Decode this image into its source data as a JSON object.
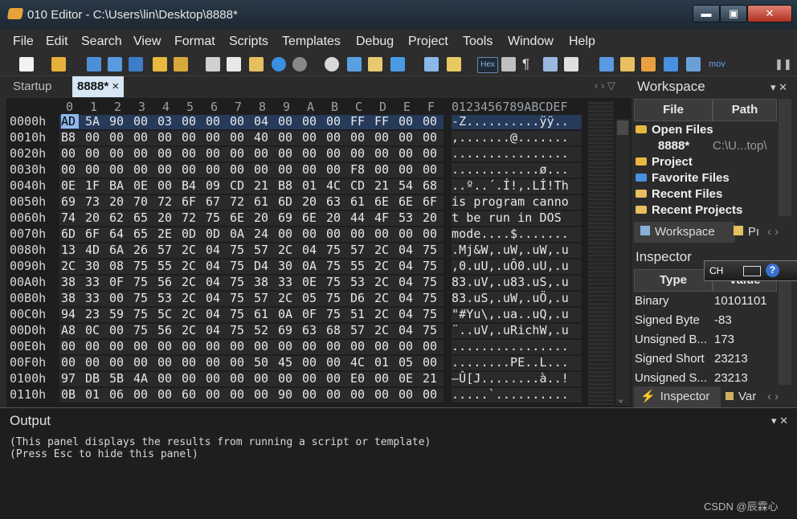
{
  "window": {
    "title": "010 Editor - C:\\Users\\lin\\Desktop\\8888*",
    "min": "▬",
    "max": "▣",
    "close": "✕"
  },
  "menu": [
    "File",
    "Edit",
    "Search",
    "View",
    "Format",
    "Scripts",
    "Templates",
    "Debug",
    "Project",
    "Tools",
    "Window",
    "Help"
  ],
  "toolbar": {
    "hex_label": "Hex",
    "mov_label": "mov",
    "icons": [
      "new-file-icon",
      "open-folder-icon",
      "save-icon",
      "save-all-icon",
      "save-copy-icon",
      "folder-icon",
      "open-multiple-icon",
      "cut-icon",
      "copy-icon",
      "paste-icon",
      "undo-icon",
      "redo-icon",
      "find-icon",
      "replace-icon",
      "find-in-files-icon",
      "goto-icon",
      "run-script-icon",
      "run-template-icon",
      "hex-icon",
      "format-icon",
      "pilcrow-icon",
      "columns-icon",
      "highlight-icon",
      "calculator-icon",
      "import-icon",
      "compare-icon",
      "histogram-icon",
      "checksum-icon",
      "mov-icon",
      "pause-icon"
    ]
  },
  "tabs": {
    "startup": "Startup",
    "file": "8888*",
    "close": "×",
    "nav": "‹ › ▽"
  },
  "hex": {
    "columns": [
      "0",
      "1",
      "2",
      "3",
      "4",
      "5",
      "6",
      "7",
      "8",
      "9",
      "A",
      "B",
      "C",
      "D",
      "E",
      "F"
    ],
    "ascii_header": "0123456789ABCDEF",
    "rows": [
      {
        "addr": "0000h",
        "bytes": [
          "AD",
          "5A",
          "90",
          "00",
          "03",
          "00",
          "00",
          "00",
          "04",
          "00",
          "00",
          "00",
          "FF",
          "FF",
          "00",
          "00"
        ],
        "ascii": "-Z..........ÿÿ.."
      },
      {
        "addr": "0010h",
        "bytes": [
          "B8",
          "00",
          "00",
          "00",
          "00",
          "00",
          "00",
          "00",
          "40",
          "00",
          "00",
          "00",
          "00",
          "00",
          "00",
          "00"
        ],
        "ascii": ",.......@......."
      },
      {
        "addr": "0020h",
        "bytes": [
          "00",
          "00",
          "00",
          "00",
          "00",
          "00",
          "00",
          "00",
          "00",
          "00",
          "00",
          "00",
          "00",
          "00",
          "00",
          "00"
        ],
        "ascii": "................"
      },
      {
        "addr": "0030h",
        "bytes": [
          "00",
          "00",
          "00",
          "00",
          "00",
          "00",
          "00",
          "00",
          "00",
          "00",
          "00",
          "00",
          "F8",
          "00",
          "00",
          "00"
        ],
        "ascii": "............ø..."
      },
      {
        "addr": "0040h",
        "bytes": [
          "0E",
          "1F",
          "BA",
          "0E",
          "00",
          "B4",
          "09",
          "CD",
          "21",
          "B8",
          "01",
          "4C",
          "CD",
          "21",
          "54",
          "68"
        ],
        "ascii": "..º..´.Í!,.LÍ!Th"
      },
      {
        "addr": "0050h",
        "bytes": [
          "69",
          "73",
          "20",
          "70",
          "72",
          "6F",
          "67",
          "72",
          "61",
          "6D",
          "20",
          "63",
          "61",
          "6E",
          "6E",
          "6F"
        ],
        "ascii": "is program canno"
      },
      {
        "addr": "0060h",
        "bytes": [
          "74",
          "20",
          "62",
          "65",
          "20",
          "72",
          "75",
          "6E",
          "20",
          "69",
          "6E",
          "20",
          "44",
          "4F",
          "53",
          "20"
        ],
        "ascii": "t be run in DOS "
      },
      {
        "addr": "0070h",
        "bytes": [
          "6D",
          "6F",
          "64",
          "65",
          "2E",
          "0D",
          "0D",
          "0A",
          "24",
          "00",
          "00",
          "00",
          "00",
          "00",
          "00",
          "00"
        ],
        "ascii": "mode....$......."
      },
      {
        "addr": "0080h",
        "bytes": [
          "13",
          "4D",
          "6A",
          "26",
          "57",
          "2C",
          "04",
          "75",
          "57",
          "2C",
          "04",
          "75",
          "57",
          "2C",
          "04",
          "75"
        ],
        "ascii": ".Mj&W,.uW,.uW,.u"
      },
      {
        "addr": "0090h",
        "bytes": [
          "2C",
          "30",
          "08",
          "75",
          "55",
          "2C",
          "04",
          "75",
          "D4",
          "30",
          "0A",
          "75",
          "55",
          "2C",
          "04",
          "75"
        ],
        "ascii": ",0.uU,.uÔ0.uU,.u"
      },
      {
        "addr": "00A0h",
        "bytes": [
          "38",
          "33",
          "0F",
          "75",
          "56",
          "2C",
          "04",
          "75",
          "38",
          "33",
          "0E",
          "75",
          "53",
          "2C",
          "04",
          "75"
        ],
        "ascii": "83.uV,.u83.uS,.u"
      },
      {
        "addr": "00B0h",
        "bytes": [
          "38",
          "33",
          "00",
          "75",
          "53",
          "2C",
          "04",
          "75",
          "57",
          "2C",
          "05",
          "75",
          "D6",
          "2C",
          "04",
          "75"
        ],
        "ascii": "83.uS,.uW,.uÖ,.u"
      },
      {
        "addr": "00C0h",
        "bytes": [
          "94",
          "23",
          "59",
          "75",
          "5C",
          "2C",
          "04",
          "75",
          "61",
          "0A",
          "0F",
          "75",
          "51",
          "2C",
          "04",
          "75"
        ],
        "ascii": "\"#Yu\\,.ua..uQ,.u"
      },
      {
        "addr": "00D0h",
        "bytes": [
          "A8",
          "0C",
          "00",
          "75",
          "56",
          "2C",
          "04",
          "75",
          "52",
          "69",
          "63",
          "68",
          "57",
          "2C",
          "04",
          "75"
        ],
        "ascii": "¨..uV,.uRichW,.u"
      },
      {
        "addr": "00E0h",
        "bytes": [
          "00",
          "00",
          "00",
          "00",
          "00",
          "00",
          "00",
          "00",
          "00",
          "00",
          "00",
          "00",
          "00",
          "00",
          "00",
          "00"
        ],
        "ascii": "................"
      },
      {
        "addr": "00F0h",
        "bytes": [
          "00",
          "00",
          "00",
          "00",
          "00",
          "00",
          "00",
          "00",
          "50",
          "45",
          "00",
          "00",
          "4C",
          "01",
          "05",
          "00"
        ],
        "ascii": "........PE..L..."
      },
      {
        "addr": "0100h",
        "bytes": [
          "97",
          "DB",
          "5B",
          "4A",
          "00",
          "00",
          "00",
          "00",
          "00",
          "00",
          "00",
          "00",
          "E0",
          "00",
          "0E",
          "21"
        ],
        "ascii": "—Û[J........à..!"
      },
      {
        "addr": "0110h",
        "bytes": [
          "0B",
          "01",
          "06",
          "00",
          "00",
          "60",
          "00",
          "00",
          "00",
          "90",
          "00",
          "00",
          "00",
          "00",
          "00",
          "00"
        ],
        "ascii": ".....`.........."
      }
    ]
  },
  "workspace": {
    "title": "Workspace",
    "controls": "▾ ✕",
    "col_file": "File",
    "col_path": "Path",
    "open_files": "Open Files",
    "file_name": "8888*",
    "file_path": "C:\\U...top\\",
    "project": "Project",
    "favorite_files": "Favorite Files",
    "recent_files": "Recent Files",
    "recent_projects": "Recent Projects",
    "tab_workspace": "Workspace",
    "tab_p": "Pı",
    "tab_nav": "‹ ›"
  },
  "inspector": {
    "title": "Inspector",
    "col_type": "Type",
    "col_value": "Value",
    "rows": [
      {
        "k": "Binary",
        "v": "10101101"
      },
      {
        "k": "Signed Byte",
        "v": "-83"
      },
      {
        "k": "Unsigned B...",
        "v": "173"
      },
      {
        "k": "Signed Short",
        "v": "23213"
      },
      {
        "k": "Unsigned S...",
        "v": "23213"
      }
    ],
    "tab_inspector": "Inspector",
    "tab_var": "Var",
    "tab_nav": "‹ ›"
  },
  "output": {
    "title": "Output",
    "controls": "▾ ✕",
    "lines": [
      "(This panel displays the results from running a script or template)",
      "(Press Esc to hide this panel)"
    ]
  },
  "ime": {
    "label": "CH",
    "help": "?"
  },
  "watermark": "CSDN @辰霖心"
}
